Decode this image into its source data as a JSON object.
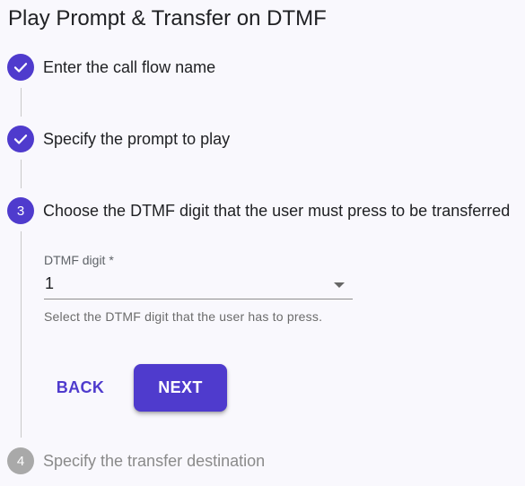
{
  "page": {
    "title": "Play Prompt & Transfer on DTMF"
  },
  "colors": {
    "accent": "#4f3bcd",
    "pending": "#a9a9a9",
    "background": "#f9f8fd"
  },
  "steps": [
    {
      "label": "Enter the call flow name",
      "status": "completed",
      "icon": "check-icon"
    },
    {
      "label": "Specify the prompt to play",
      "status": "completed",
      "icon": "check-icon"
    },
    {
      "number": "3",
      "label": "Choose the DTMF digit that the user must press to be transferred",
      "status": "active"
    },
    {
      "number": "4",
      "label": "Specify the transfer destination",
      "status": "pending"
    }
  ],
  "dtmf_field": {
    "label": "DTMF digit *",
    "value": "1",
    "helper": "Select the DTMF digit that the user has to press.",
    "icon": "dropdown-arrow-icon"
  },
  "actions": {
    "back_label": "BACK",
    "next_label": "NEXT"
  }
}
